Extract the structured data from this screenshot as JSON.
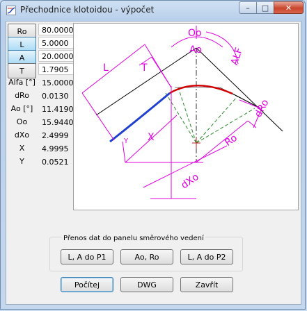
{
  "window": {
    "title": "Přechodnice klotoidou - výpočet",
    "close_glyph": "✕",
    "max_glyph": "□",
    "min_glyph": "–"
  },
  "params": [
    {
      "label": "Ro",
      "value": "80.0000",
      "button": true,
      "active": false
    },
    {
      "label": "L",
      "value": "5.0000",
      "button": true,
      "active": true
    },
    {
      "label": "A",
      "value": "20.0000",
      "button": true,
      "active": true
    },
    {
      "label": "T",
      "value": "1.7905",
      "button": true,
      "active": false
    },
    {
      "label": "Alfa [°]",
      "value": "15.0000",
      "button": false
    },
    {
      "label": "dRo",
      "value": "0.0130",
      "button": false
    },
    {
      "label": "Ao [°]",
      "value": "11.4190",
      "button": false
    },
    {
      "label": "Oo",
      "value": "15.9440",
      "button": false
    },
    {
      "label": "dXo",
      "value": "2.4999",
      "button": false
    },
    {
      "label": "X",
      "value": "4.9995",
      "button": false
    },
    {
      "label": "Y",
      "value": "0.0521",
      "button": false
    }
  ],
  "diagram": {
    "labels": {
      "Oo": "Oo",
      "Ao": "Ao",
      "ALF": "ALF",
      "L": "L",
      "T": "T",
      "Y": "Y",
      "X": "X",
      "Ro": "Ro",
      "dRo": "dRo",
      "dXo": "dXo"
    },
    "colors": {
      "dimension": "#e000e0",
      "clothoid": "#1f3fd0",
      "arc": "#d00000",
      "radial": "#2a8a2a",
      "tangent": "#000000"
    }
  },
  "transfer": {
    "group_label": "Přenos dat do panelu směrového vedení",
    "btn_p1": "L, A do P1",
    "btn_ao_ro": "Ao, Ro",
    "btn_p2": "L, A do P2"
  },
  "actions": {
    "compute": "Počítej",
    "dwg": "DWG",
    "close": "Zavřít"
  }
}
